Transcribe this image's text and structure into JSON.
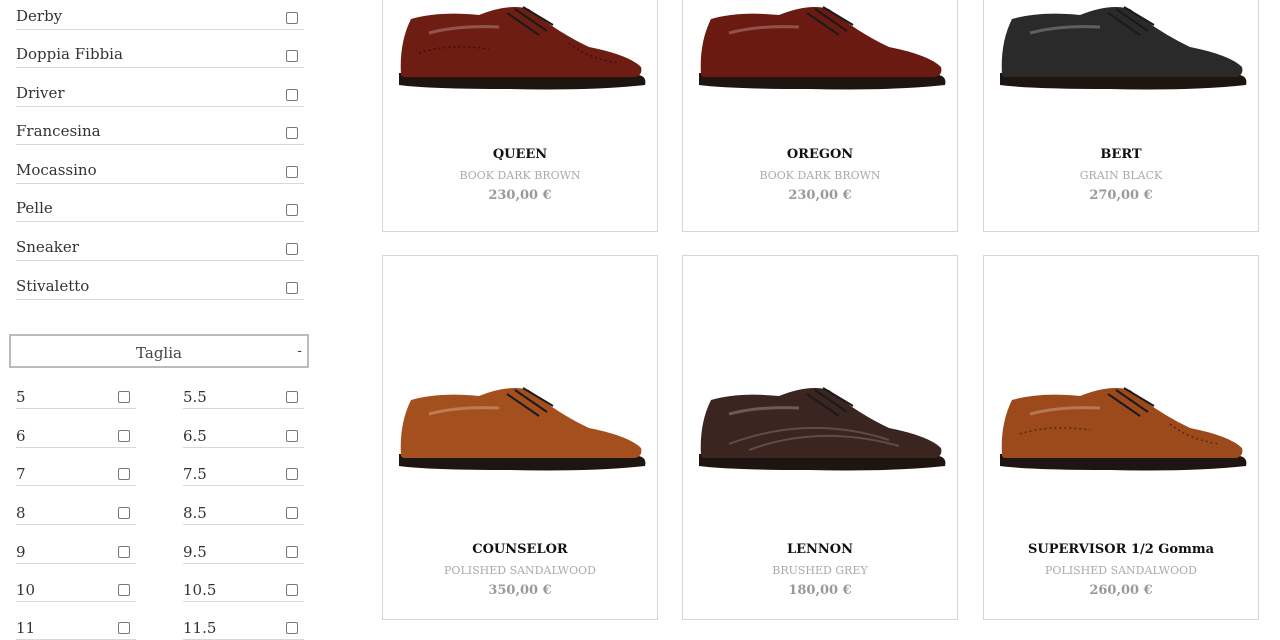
{
  "categories": [
    {
      "label": "Derby"
    },
    {
      "label": "Doppia Fibbia"
    },
    {
      "label": "Driver"
    },
    {
      "label": "Francesina"
    },
    {
      "label": "Mocassino"
    },
    {
      "label": "Pelle"
    },
    {
      "label": "Sneaker"
    },
    {
      "label": "Stivaletto"
    }
  ],
  "size_filter": {
    "title": "Taglia",
    "toggle": "-",
    "sizes": [
      {
        "left": "5",
        "right": "5.5"
      },
      {
        "left": "6",
        "right": "6.5"
      },
      {
        "left": "7",
        "right": "7.5"
      },
      {
        "left": "8",
        "right": "8.5"
      },
      {
        "left": "9",
        "right": "9.5"
      },
      {
        "left": "10",
        "right": "10.5"
      },
      {
        "left": "11",
        "right": "11.5"
      }
    ]
  },
  "products": [
    {
      "name": "QUEEN",
      "variant": "BOOK DARK BROWN",
      "price": "230,00 €",
      "color": "#6e1d12",
      "style": "brogue"
    },
    {
      "name": "OREGON",
      "variant": "BOOK DARK BROWN",
      "price": "230,00 €",
      "color": "#6a1a10",
      "style": "derby"
    },
    {
      "name": "BERT",
      "variant": "GRAIN BLACK",
      "price": "270,00 €",
      "color": "#2a2a2a",
      "style": "derby"
    },
    {
      "name": "COUNSELOR",
      "variant": "POLISHED SANDALWOOD",
      "price": "350,00 €",
      "color": "#a4501e",
      "style": "derby"
    },
    {
      "name": "LENNON",
      "variant": "BRUSHED GREY",
      "price": "180,00 €",
      "color": "#3a2520",
      "style": "sneaker"
    },
    {
      "name": "SUPERVISOR 1/2 Gomma",
      "variant": "POLISHED SANDALWOOD",
      "price": "260,00 €",
      "color": "#9c4a1c",
      "style": "brogue"
    }
  ]
}
